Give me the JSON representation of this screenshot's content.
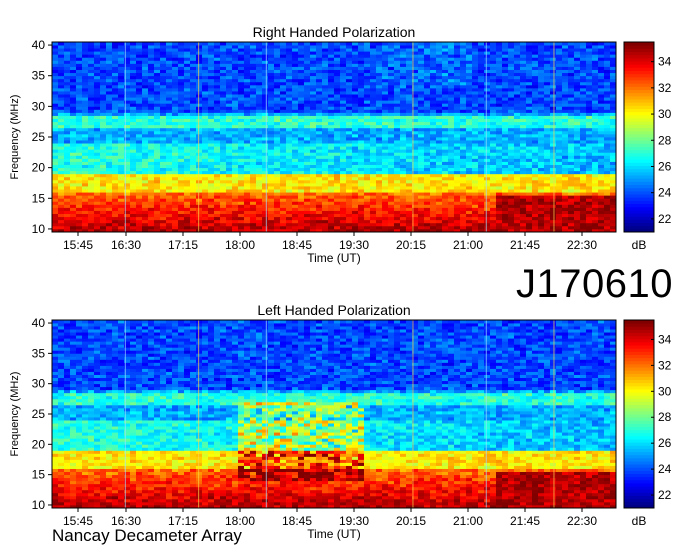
{
  "header": {
    "label": "J170610"
  },
  "footer": {
    "label": "Nancay Decameter Array"
  },
  "chart_data": [
    {
      "type": "heatmap",
      "title": "Right Handed Polarization",
      "xlabel": "Time (UT)",
      "ylabel": "Frequency (MHz)",
      "x_ticks": [
        "15:45",
        "16:30",
        "17:15",
        "18:00",
        "18:45",
        "19:30",
        "20:15",
        "21:00",
        "21:45",
        "22:30"
      ],
      "y_ticks": [
        10,
        15,
        20,
        25,
        30,
        35,
        40
      ],
      "ylim": [
        9.5,
        40.5
      ],
      "colorbar": {
        "unit": "dB",
        "ticks": [
          22,
          24,
          26,
          28,
          30,
          32,
          34
        ],
        "range": [
          21,
          35.5
        ]
      },
      "colors": [
        "#00007f",
        "#0000ff",
        "#0080ff",
        "#00ffff",
        "#80ff80",
        "#ffff00",
        "#ff8000",
        "#ff0000",
        "#7f0000"
      ]
    },
    {
      "type": "heatmap",
      "title": "Left Handed Polarization",
      "xlabel": "Time (UT)",
      "ylabel": "Frequency (MHz)",
      "x_ticks": [
        "15:45",
        "16:30",
        "17:15",
        "18:00",
        "18:45",
        "19:30",
        "20:15",
        "21:00",
        "21:45",
        "22:30"
      ],
      "y_ticks": [
        10,
        15,
        20,
        25,
        30,
        35,
        40
      ],
      "ylim": [
        9.5,
        40.5
      ],
      "colorbar": {
        "unit": "dB",
        "ticks": [
          22,
          24,
          26,
          28,
          30,
          32,
          34
        ],
        "range": [
          21,
          35.5
        ]
      },
      "colors": [
        "#00007f",
        "#0000ff",
        "#0080ff",
        "#00ffff",
        "#80ff80",
        "#ffff00",
        "#ff8000",
        "#ff0000",
        "#7f0000"
      ]
    }
  ]
}
